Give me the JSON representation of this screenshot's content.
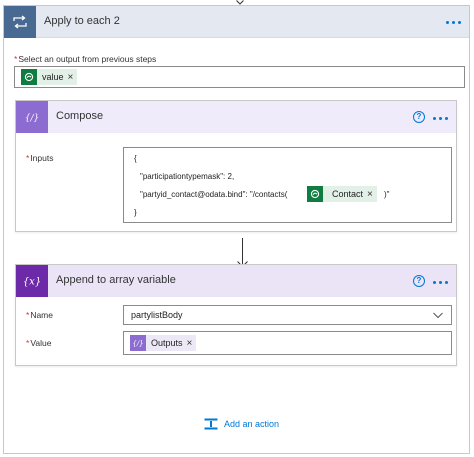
{
  "apply_each": {
    "title": "Apply to each 2",
    "select_label": "Select an output from previous steps",
    "token": "value"
  },
  "compose": {
    "title": "Compose",
    "help": "?",
    "inputs_label": "Inputs",
    "lines": {
      "open": "{",
      "l1": "\"participationtypemask\": 2,",
      "l2_prefix": "\"partyid_contact@odata.bind\": \"/contacts(",
      "l2_token": "Contact",
      "l2_suffix": ")\"",
      "close": "}"
    }
  },
  "append": {
    "title": "Append to array variable",
    "help": "?",
    "name_label": "Name",
    "name_value": "partylistBody",
    "value_label": "Value",
    "value_token": "Outputs"
  },
  "add_action": {
    "label": "Add an action"
  },
  "token_remove": "×",
  "required_marker": "*",
  "colors": {
    "loop_icon": "#486991",
    "compose_icon": "#8c6cd0",
    "append_icon": "#6d2aa8",
    "dataverse_token": "#107c41",
    "link": "#0078d4"
  }
}
